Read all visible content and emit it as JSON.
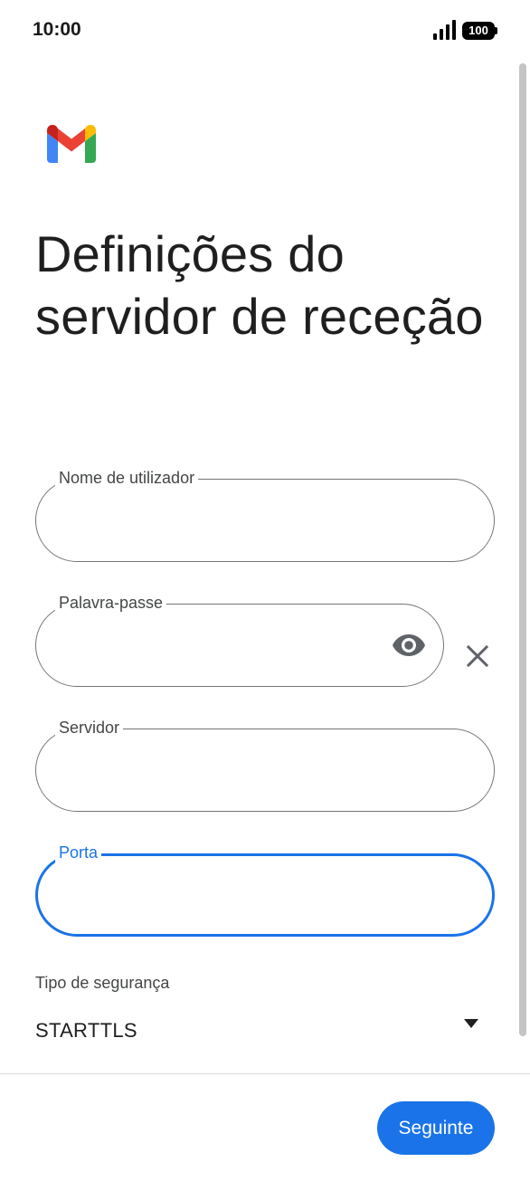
{
  "status_bar": {
    "time": "10:00",
    "battery_level": "100",
    "icons": [
      "signal-icon",
      "battery-icon"
    ]
  },
  "logo": {
    "icon": "gmail-logo"
  },
  "title": "Definições do servidor de receção",
  "fields": {
    "username": {
      "label": "Nome de utilizador",
      "value": "",
      "focused": false
    },
    "password": {
      "label": "Palavra-passe",
      "value": "",
      "focused": false,
      "icons": [
        "eye-icon",
        "close-icon"
      ]
    },
    "server": {
      "label": "Servidor",
      "value": "",
      "focused": false
    },
    "port": {
      "label": "Porta",
      "value": "",
      "focused": true
    }
  },
  "security": {
    "label": "Tipo de segurança",
    "value": "STARTTLS",
    "icon": "dropdown-arrow-icon"
  },
  "actions": {
    "next_label": "Seguinte"
  },
  "colors": {
    "accent": "#1a73e8",
    "outline": "#757575",
    "text": "#1f1f1f",
    "secondary_text": "#444746"
  }
}
